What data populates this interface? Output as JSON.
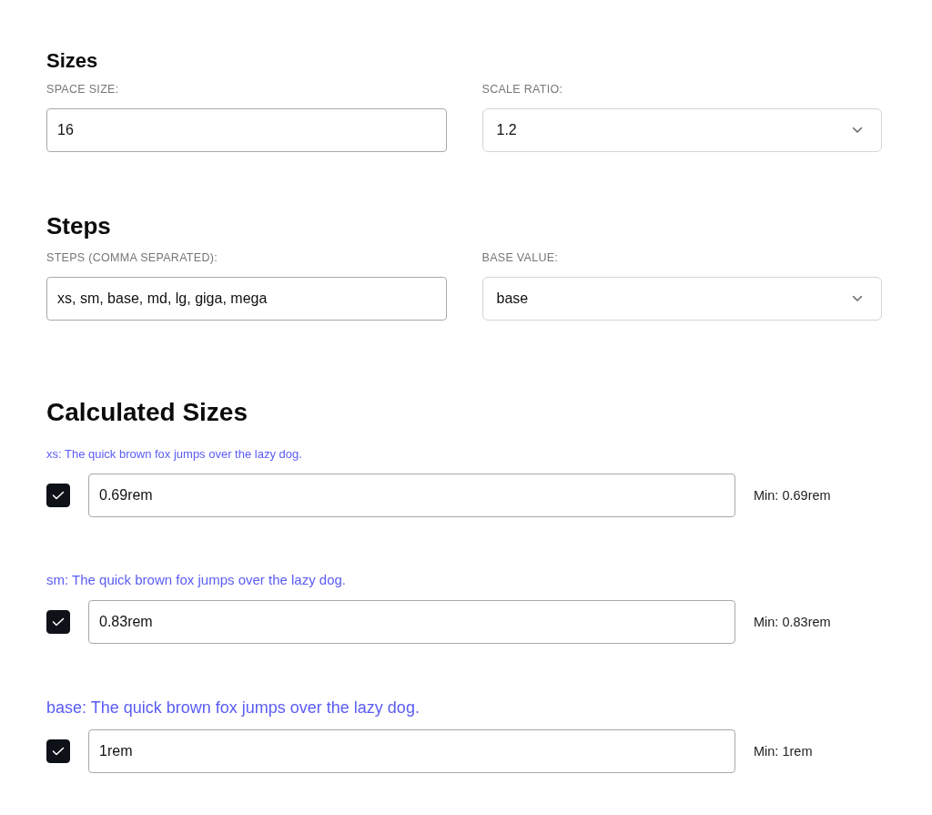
{
  "sections": [
    {
      "heading": "Sizes",
      "fields": [
        {
          "kind": "input",
          "label": "SPACE SIZE:",
          "value": "16"
        },
        {
          "kind": "select",
          "label": "SCALE RATIO:",
          "value": "1.2"
        }
      ]
    },
    {
      "heading": "Steps",
      "fields": [
        {
          "kind": "input",
          "label": "STEPS (COMMA SEPARATED):",
          "value": "xs, sm, base, md, lg, giga, mega"
        },
        {
          "kind": "select",
          "label": "BASE VALUE:",
          "value": "base"
        }
      ]
    }
  ],
  "calculated": {
    "heading": "Calculated Sizes",
    "rows": [
      {
        "sample": "xs: The quick brown fox jumps over the lazy dog.",
        "checked": true,
        "value": "0.69rem",
        "min": "Min: 0.69rem"
      },
      {
        "sample": "sm: The quick brown fox jumps over the lazy dog.",
        "checked": true,
        "value": "0.83rem",
        "min": "Min: 0.83rem"
      },
      {
        "sample": "base: The quick brown fox jumps over the lazy dog.",
        "checked": true,
        "value": "1rem",
        "min": "Min: 1rem"
      }
    ]
  }
}
